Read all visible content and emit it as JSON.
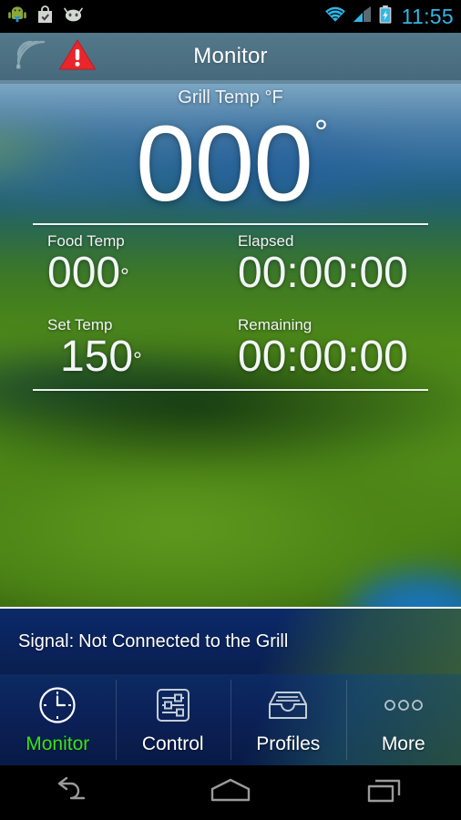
{
  "statusbar": {
    "time": "11:55",
    "left_icons": [
      "android-mascot-icon",
      "play-store-bag-icon",
      "android-head-icon"
    ],
    "right_icons": [
      "wifi-icon",
      "cell-signal-icon",
      "battery-charging-icon"
    ],
    "accent_color": "#33b5e5"
  },
  "titlebar": {
    "title": "Monitor",
    "icons": [
      "signal-waves-icon",
      "warning-triangle-icon"
    ],
    "warning_color": "#e8262b",
    "background_color": "#4c7183"
  },
  "readings": {
    "grill": {
      "label": "Grill Temp °F",
      "value": "000",
      "degree": "°"
    },
    "food": {
      "label": "Food Temp",
      "value": "000",
      "degree": "°"
    },
    "elapsed": {
      "label": "Elapsed",
      "value": "00:00:00"
    },
    "set": {
      "label": "Set Temp",
      "value": "150",
      "degree": "°"
    },
    "remaining": {
      "label": "Remaining",
      "value": "00:00:00"
    }
  },
  "signal": {
    "key": "Signal:",
    "status": "Not Connected to the Grill"
  },
  "tabs": [
    {
      "label": "Monitor",
      "icon": "clock-icon",
      "active": true,
      "active_color": "#35e519"
    },
    {
      "label": "Control",
      "icon": "sliders-icon",
      "active": false
    },
    {
      "label": "Profiles",
      "icon": "inbox-tray-icon",
      "active": false
    },
    {
      "label": "More",
      "icon": "three-circles-icon",
      "active": false
    }
  ],
  "navbar": {
    "buttons": [
      "back-icon",
      "home-icon",
      "recents-icon"
    ]
  }
}
